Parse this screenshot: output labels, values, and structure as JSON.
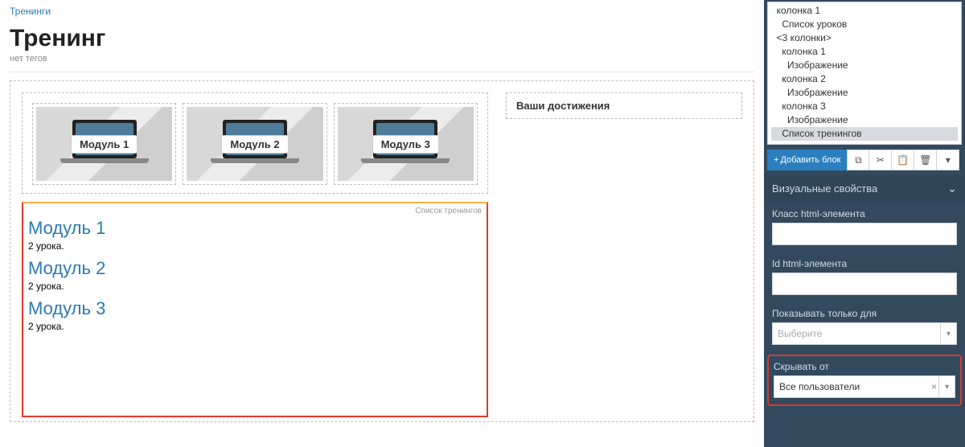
{
  "breadcrumb": "Тренинги",
  "page_title": "Тренинг",
  "no_tags": "нет тегов",
  "modules": {
    "cards": [
      {
        "label": "Модуль 1"
      },
      {
        "label": "Модуль 2"
      },
      {
        "label": "Модуль 3"
      }
    ]
  },
  "achievements_title": "Ваши достижения",
  "training_list": {
    "badge": "Список тренингов",
    "items": [
      {
        "title": "Модуль 1",
        "subtitle": "2 урока."
      },
      {
        "title": "Модуль 2",
        "subtitle": "2 урока."
      },
      {
        "title": "Модуль 3",
        "subtitle": "2 урока."
      }
    ]
  },
  "sidebar": {
    "tree": [
      {
        "indent": 1,
        "text": "колонка 1"
      },
      {
        "indent": 2,
        "text": "Список уроков"
      },
      {
        "indent": 1,
        "text": "<3 колонки>"
      },
      {
        "indent": 2,
        "text": "колонка 1"
      },
      {
        "indent": 3,
        "text": "Изображение"
      },
      {
        "indent": 2,
        "text": "колонка 2"
      },
      {
        "indent": 3,
        "text": "Изображение"
      },
      {
        "indent": 2,
        "text": "колонка 3"
      },
      {
        "indent": 3,
        "text": "Изображение"
      },
      {
        "indent": 2,
        "text": "Список тренингов",
        "selected": true
      }
    ],
    "add_block": "Добавить блок",
    "panel_title": "Визуальные свойства",
    "fields": {
      "css_class_label": "Класс html-элемента",
      "css_class_value": "",
      "id_label": "Id html-элемента",
      "id_value": "",
      "show_for_label": "Показывать только для",
      "show_for_placeholder": "Выберите",
      "hide_from_label": "Скрывать от",
      "hide_from_value": "Все пользователи"
    }
  }
}
